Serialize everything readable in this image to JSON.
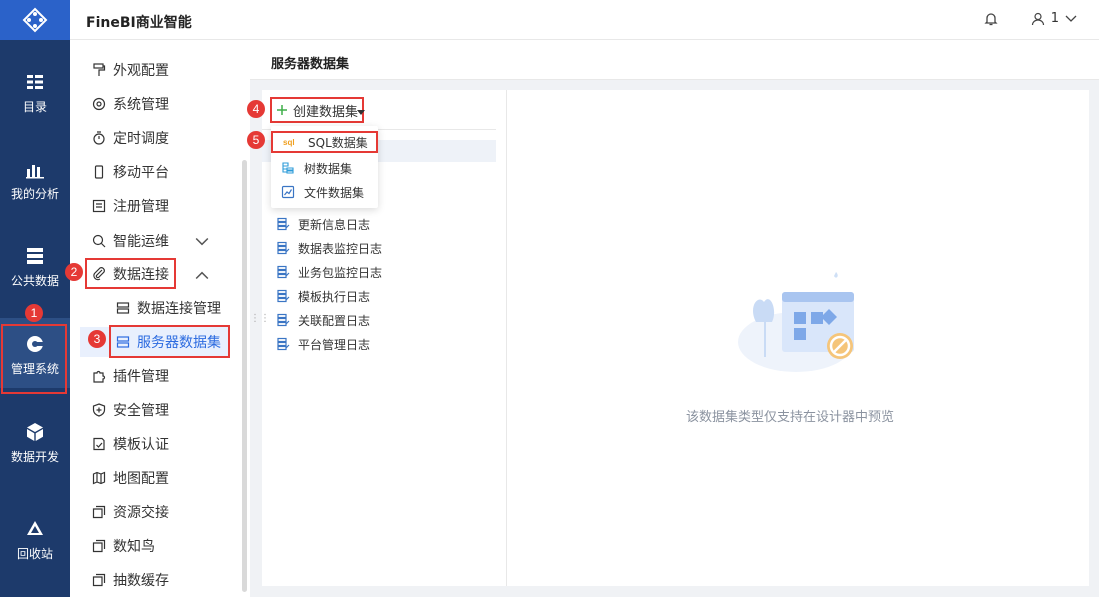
{
  "header": {
    "app_title": "FineBI商业智能",
    "user_label": "1"
  },
  "rail": {
    "items": [
      {
        "label": "目录",
        "icon": "catalog-icon"
      },
      {
        "label": "我的分析",
        "icon": "analysis-icon"
      },
      {
        "label": "公共数据",
        "icon": "public-data-icon"
      },
      {
        "label": "管理系统",
        "icon": "gear-icon",
        "active": true
      },
      {
        "label": "数据开发",
        "icon": "cube-icon"
      },
      {
        "label": "回收站",
        "icon": "recycle-icon"
      }
    ]
  },
  "menu": {
    "items": [
      {
        "label": "外观配置",
        "icon": "paint-roller-icon"
      },
      {
        "label": "系统管理",
        "icon": "settings-icon"
      },
      {
        "label": "定时调度",
        "icon": "timer-icon"
      },
      {
        "label": "移动平台",
        "icon": "mobile-icon"
      },
      {
        "label": "注册管理",
        "icon": "register-icon"
      },
      {
        "label": "智能运维",
        "icon": "ops-icon",
        "expandable": true
      },
      {
        "label": "数据连接",
        "icon": "link-icon",
        "expanded": true
      },
      {
        "label": "数据连接管理",
        "icon": "db-connect-icon",
        "sub": true
      },
      {
        "label": "服务器数据集",
        "icon": "server-dataset-icon",
        "sub": true,
        "selected": true
      },
      {
        "label": "插件管理",
        "icon": "plugin-icon"
      },
      {
        "label": "安全管理",
        "icon": "shield-icon"
      },
      {
        "label": "模板认证",
        "icon": "template-icon"
      },
      {
        "label": "地图配置",
        "icon": "map-icon"
      },
      {
        "label": "资源交接",
        "icon": "resource-icon"
      },
      {
        "label": "数知鸟",
        "icon": "bird-icon"
      },
      {
        "label": "抽数缓存",
        "icon": "cache-icon"
      }
    ]
  },
  "main": {
    "title": "服务器数据集",
    "create_button": "创建数据集",
    "dropdown": [
      "SQL数据集",
      "树数据集",
      "文件数据集"
    ],
    "dropdown_icons": [
      "sql-icon",
      "tree-icon",
      "file-icon"
    ],
    "tree": [
      "更新信息日志",
      "数据表监控日志",
      "业务包监控日志",
      "模板执行日志",
      "关联配置日志",
      "平台管理日志"
    ],
    "empty_text": "该数据集类型仅支持在设计器中预览"
  },
  "annotations": [
    "1",
    "2",
    "3",
    "4",
    "5"
  ],
  "colors": {
    "accent": "#2c6be0",
    "rail_bg": "#1d3a6b",
    "highlight": "#e53935"
  }
}
